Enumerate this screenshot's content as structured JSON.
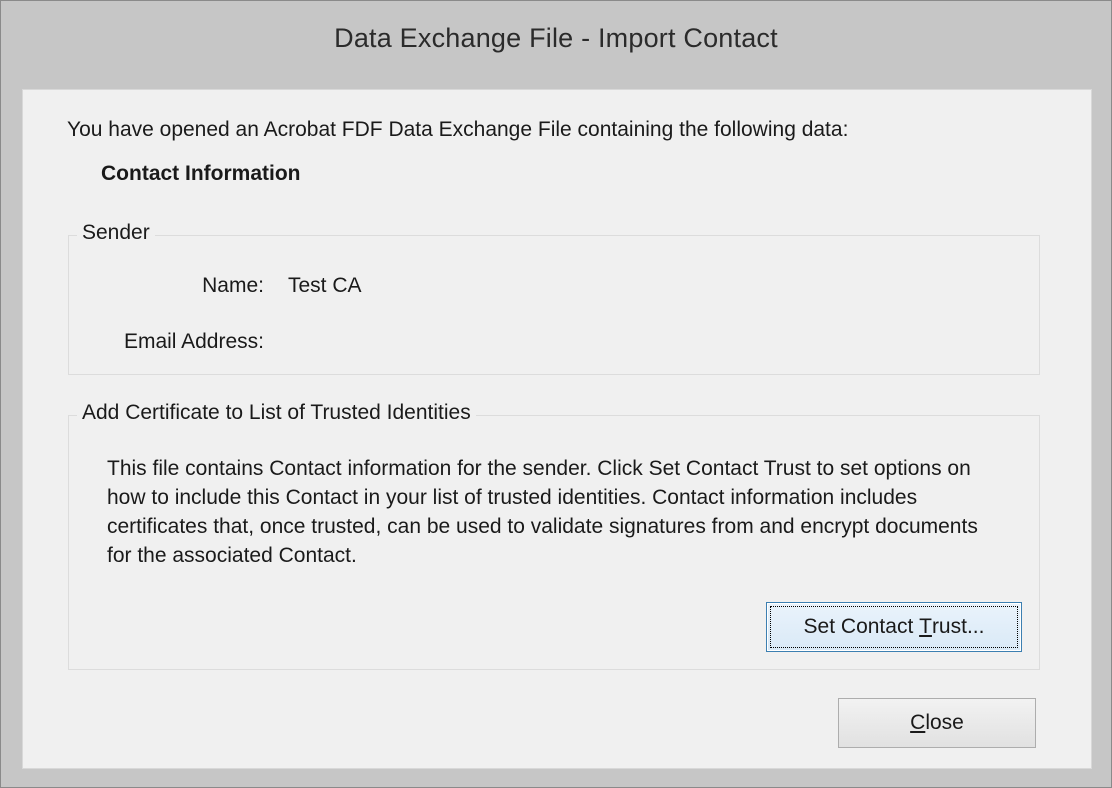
{
  "window": {
    "title": "Data Exchange File - Import Contact"
  },
  "dialog": {
    "intro_text": "You have opened an Acrobat FDF Data Exchange File containing the following data:",
    "section_heading": "Contact Information"
  },
  "sender": {
    "legend": "Sender",
    "name_label": "Name:",
    "name_value": "Test CA",
    "email_label": "Email Address:",
    "email_value": ""
  },
  "certificate": {
    "legend": "Add Certificate to List of Trusted Identities",
    "description": "This file contains Contact information for the sender. Click Set Contact Trust to set options on how to include this Contact in your list of trusted identities. Contact information includes certificates that, once trusted, can be used to validate signatures from and encrypt documents for the associated Contact.",
    "set_trust_button": {
      "prefix": "Set Contact ",
      "mnemonic": "T",
      "suffix": "rust..."
    }
  },
  "buttons": {
    "close": {
      "prefix": "",
      "mnemonic": "C",
      "suffix": "lose"
    }
  }
}
